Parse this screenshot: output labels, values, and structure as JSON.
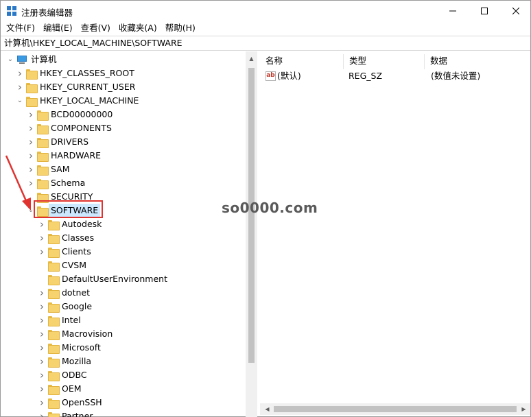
{
  "window": {
    "title": "注册表编辑器"
  },
  "menu": {
    "items": [
      "文件(F)",
      "编辑(E)",
      "查看(V)",
      "收藏夹(A)",
      "帮助(H)"
    ]
  },
  "address": {
    "path": "计算机\\HKEY_LOCAL_MACHINE\\SOFTWARE"
  },
  "tree": {
    "root": "计算机",
    "hives": [
      "HKEY_CLASSES_ROOT",
      "HKEY_CURRENT_USER",
      "HKEY_LOCAL_MACHINE"
    ],
    "hklm_children": [
      "BCD00000000",
      "COMPONENTS",
      "DRIVERS",
      "HARDWARE",
      "SAM",
      "Schema",
      "SECURITY",
      "SOFTWARE"
    ],
    "software_children": [
      "Autodesk",
      "Classes",
      "Clients",
      "CVSM",
      "DefaultUserEnvironment",
      "dotnet",
      "Google",
      "Intel",
      "Macrovision",
      "Microsoft",
      "Mozilla",
      "ODBC",
      "OEM",
      "OpenSSH",
      "Partner"
    ]
  },
  "list": {
    "columns": [
      "名称",
      "类型",
      "数据"
    ],
    "rows": [
      {
        "icon": "ab",
        "name": "(默认)",
        "type": "REG_SZ",
        "data": "(数值未设置)"
      }
    ]
  },
  "watermark": "so0000.com",
  "colors": {
    "selection": "#cce8ff",
    "highlight_box": "#e0332f",
    "folder": "#f6d36e"
  }
}
